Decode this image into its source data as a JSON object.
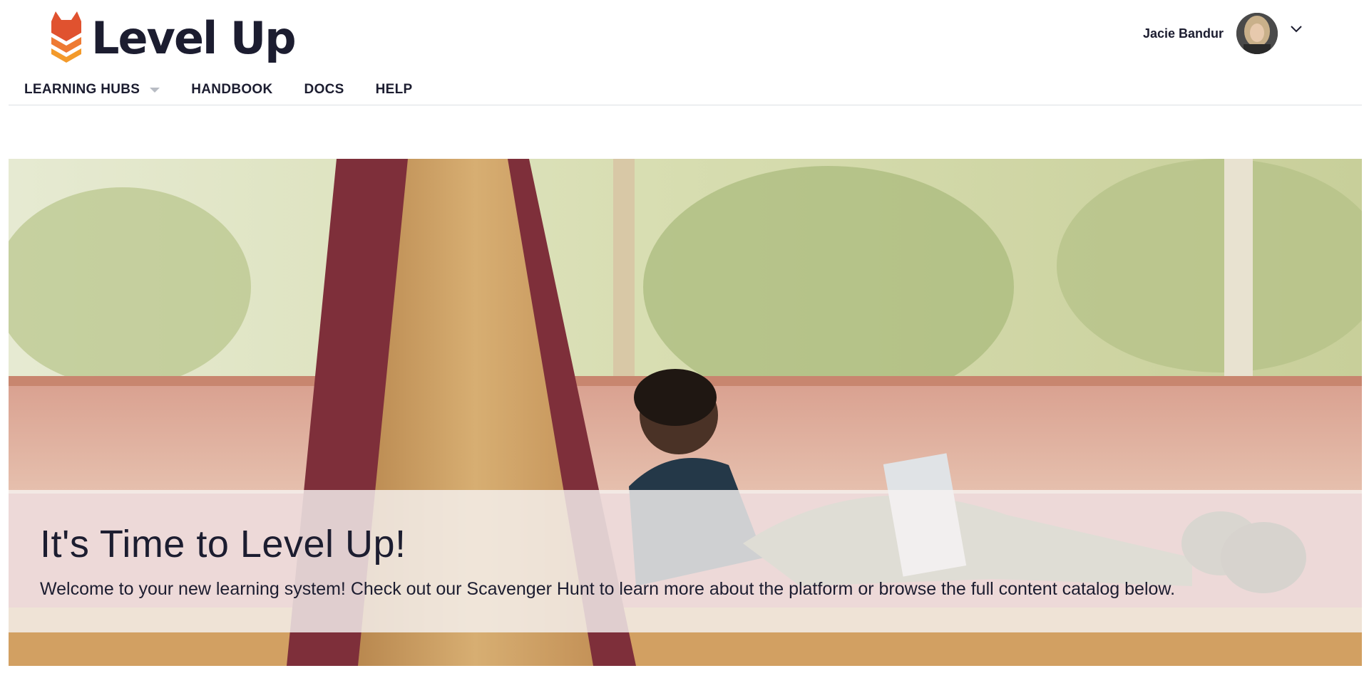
{
  "brand": {
    "name": "Level Up",
    "logo_icon": "fox-chevron-logo-icon",
    "colors": {
      "primary": "#e0522f",
      "secondary": "#f39a2b",
      "text": "#1c1d30"
    }
  },
  "user": {
    "name": "Jacie Bandur",
    "menu_icon": "chevron-down-icon"
  },
  "nav": {
    "items": [
      {
        "label": "LEARNING HUBS",
        "has_dropdown": true
      },
      {
        "label": "HANDBOOK"
      },
      {
        "label": "DOCS"
      },
      {
        "label": "HELP"
      }
    ]
  },
  "hero": {
    "title": "It's Time to Level Up!",
    "subtitle": "Welcome to your new learning system! Check out our Scavenger Hunt to learn more about the platform or browse the full content catalog below."
  }
}
